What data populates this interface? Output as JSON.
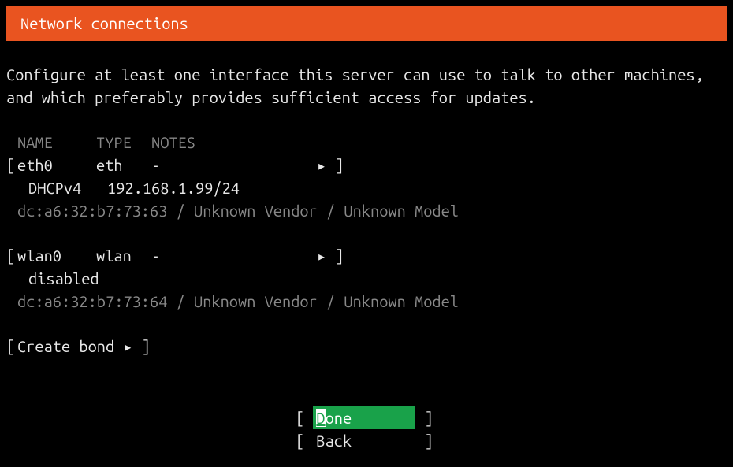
{
  "header": {
    "title": "Network connections"
  },
  "description": "Configure at least one interface this server can use to talk to other machines, and which preferably provides sufficient access for updates.",
  "columns": {
    "name": "NAME",
    "type": "TYPE",
    "notes": "NOTES"
  },
  "interfaces": [
    {
      "name": "eth0",
      "type": "eth",
      "notes": "-",
      "arrow": "▸",
      "sub_proto": "DHCPv4",
      "sub_addr": "192.168.1.99/24",
      "hw": "dc:a6:32:b7:73:63 / Unknown Vendor / Unknown Model"
    },
    {
      "name": "wlan0",
      "type": "wlan",
      "notes": "-",
      "arrow": "▸",
      "disabled_label": "disabled",
      "hw": "dc:a6:32:b7:73:64 / Unknown Vendor / Unknown Model"
    }
  ],
  "create_bond": {
    "label": "Create bond",
    "arrow": "▸"
  },
  "buttons": {
    "done_first": "D",
    "done_rest": "one",
    "back": "Back"
  },
  "brackets": {
    "open": "[",
    "close": "]"
  }
}
